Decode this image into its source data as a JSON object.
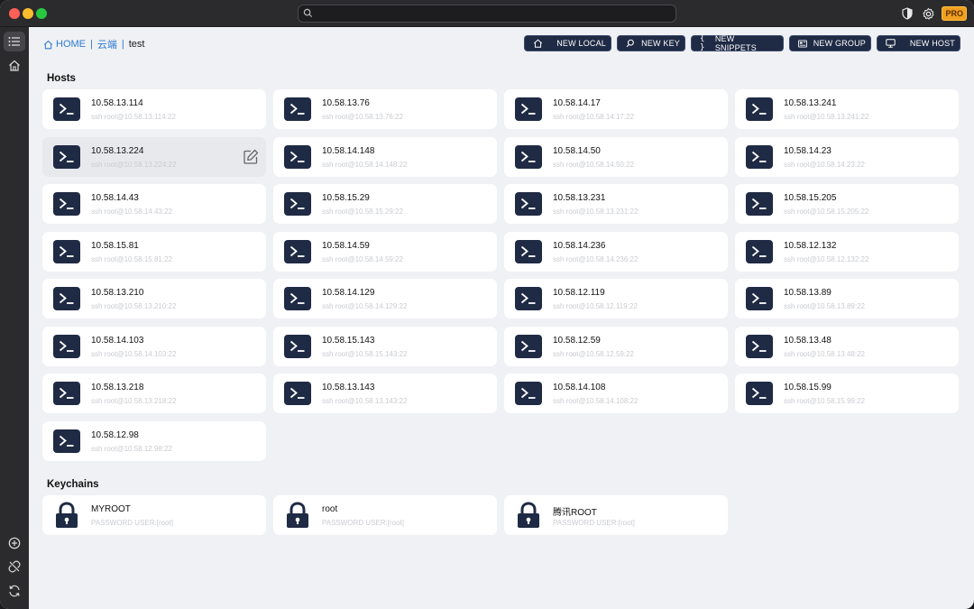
{
  "titlebar": {
    "search_placeholder": "",
    "pro_badge": "PRO",
    "icons": [
      "shield-icon",
      "gear-icon"
    ]
  },
  "sidebar": {
    "top_icons": [
      "list-icon",
      "home-icon"
    ],
    "bottom_icons": [
      "plus-circle-icon",
      "link-off-icon",
      "sync-icon"
    ]
  },
  "breadcrumb": {
    "home": "HOME",
    "cloud": "云端",
    "current": "test"
  },
  "actions": [
    {
      "label": "NEW LOCAL",
      "icon": "home-icon"
    },
    {
      "label": "NEW KEY",
      "icon": "search-icon"
    },
    {
      "label": "NEW SNIPPETS",
      "icon": "braces-icon"
    },
    {
      "label": "NEW GROUP",
      "icon": "group-icon"
    },
    {
      "label": "NEW HOST",
      "icon": "monitor-icon"
    }
  ],
  "sections": {
    "hosts": "Hosts",
    "keychains": "Keychains"
  },
  "hosts": [
    {
      "ip": "10.58.13.114",
      "cmd": "ssh root@10.58.13.114:22"
    },
    {
      "ip": "10.58.13.76",
      "cmd": "ssh root@10.58.13.76:22"
    },
    {
      "ip": "10.58.14.17",
      "cmd": "ssh root@10.58.14.17:22"
    },
    {
      "ip": "10.58.13.241",
      "cmd": "ssh root@10.58.13.241:22"
    },
    {
      "ip": "10.58.13.224",
      "cmd": "ssh root@10.58.13.224:22"
    },
    {
      "ip": "10.58.14.148",
      "cmd": "ssh root@10.58.14.148:22"
    },
    {
      "ip": "10.58.14.50",
      "cmd": "ssh root@10.58.14.50:22"
    },
    {
      "ip": "10.58.14.23",
      "cmd": "ssh root@10.58.14.23:22"
    },
    {
      "ip": "10.58.14.43",
      "cmd": "ssh root@10.58.14.43:22"
    },
    {
      "ip": "10.58.15.29",
      "cmd": "ssh root@10.58.15.29:22"
    },
    {
      "ip": "10.58.13.231",
      "cmd": "ssh root@10.58.13.231:22"
    },
    {
      "ip": "10.58.15.205",
      "cmd": "ssh root@10.58.15.205:22"
    },
    {
      "ip": "10.58.15.81",
      "cmd": "ssh root@10.58.15.81:22"
    },
    {
      "ip": "10.58.14.59",
      "cmd": "ssh root@10.58.14.59:22"
    },
    {
      "ip": "10.58.14.236",
      "cmd": "ssh root@10.58.14.236:22"
    },
    {
      "ip": "10.58.12.132",
      "cmd": "ssh root@10.58.12.132:22"
    },
    {
      "ip": "10.58.13.210",
      "cmd": "ssh root@10.58.13.210:22"
    },
    {
      "ip": "10.58.14.129",
      "cmd": "ssh root@10.58.14.129:22"
    },
    {
      "ip": "10.58.12.119",
      "cmd": "ssh root@10.58.12.119:22"
    },
    {
      "ip": "10.58.13.89",
      "cmd": "ssh root@10.58.13.89:22"
    },
    {
      "ip": "10.58.14.103",
      "cmd": "ssh root@10.58.14.103:22"
    },
    {
      "ip": "10.58.15.143",
      "cmd": "ssh root@10.58.15.143:22"
    },
    {
      "ip": "10.58.12.59",
      "cmd": "ssh root@10.58.12.59:22"
    },
    {
      "ip": "10.58.13.48",
      "cmd": "ssh root@10.58.13.48:22"
    },
    {
      "ip": "10.58.13.218",
      "cmd": "ssh root@10.58.13.218:22"
    },
    {
      "ip": "10.58.13.143",
      "cmd": "ssh root@10.58.13.143:22"
    },
    {
      "ip": "10.58.14.108",
      "cmd": "ssh root@10.58.14.108:22"
    },
    {
      "ip": "10.58.15.99",
      "cmd": "ssh root@10.58.15.99:22"
    },
    {
      "ip": "10.58.12.98",
      "cmd": "ssh root@10.58.12.98:22"
    }
  ],
  "hovered_host": "10.58.13.224",
  "keychains": [
    {
      "name": "MYROOT",
      "desc": "PASSWORD USER:[root]"
    },
    {
      "name": "root",
      "desc": "PASSWORD USER:[root]"
    },
    {
      "name": "腾讯ROOT",
      "desc": "PASSWORD USER:[root]"
    }
  ],
  "colors": {
    "accent_navy": "#1f2a44",
    "link_blue": "#2c7ad0",
    "pro_orange": "#f0a020"
  }
}
